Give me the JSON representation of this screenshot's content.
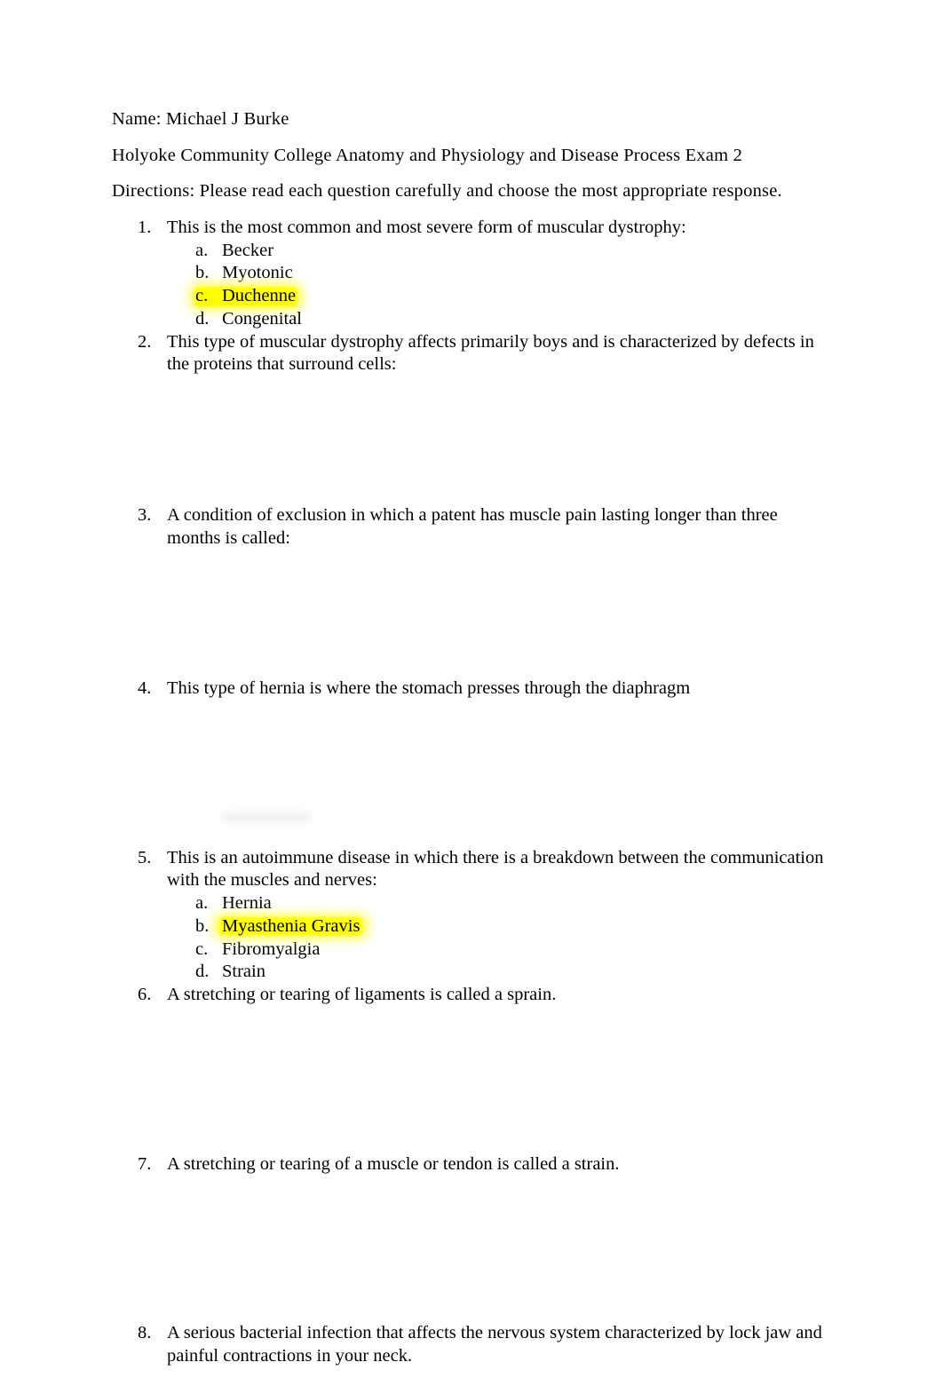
{
  "document": {
    "name_line": "Name: Michael J Burke",
    "title_line": "Holyoke Community College Anatomy and Physiology and Disease Process Exam 2",
    "directions_line": "Directions: Please read each question carefully and choose the most appropriate response."
  },
  "highlight_color": "#FFFF00",
  "questions": [
    {
      "number": "1.",
      "text": "This is the most common and most severe form of muscular dystrophy:",
      "options": [
        {
          "marker": "a.",
          "text": "Becker",
          "highlighted": false
        },
        {
          "marker": "b.",
          "text": "Myotonic",
          "highlighted": false
        },
        {
          "marker": "c.",
          "text": "Duchenne",
          "highlighted": true
        },
        {
          "marker": "d.",
          "text": "Congenital",
          "highlighted": false
        }
      ]
    },
    {
      "number": "2.",
      "text": "This type of muscular dystrophy affects primarily boys and is characterized by defects in the proteins that surround cells:",
      "options": []
    },
    {
      "number": "3.",
      "text": "A condition of exclusion in which a patent has muscle pain lasting longer than three months is called:",
      "options": []
    },
    {
      "number": "4.",
      "text": "This type of hernia is where the stomach presses through the diaphragm",
      "options": []
    },
    {
      "number": "5.",
      "text": "This is an autoimmune disease in which there is a breakdown between the communication with the muscles and nerves:",
      "options": [
        {
          "marker": "a.",
          "text": "Hernia",
          "highlighted": false
        },
        {
          "marker": "b.",
          "text": "Myasthenia Gravis",
          "highlighted": true
        },
        {
          "marker": "c.",
          "text": "Fibromyalgia",
          "highlighted": false
        },
        {
          "marker": "d.",
          "text": "Strain",
          "highlighted": false
        }
      ]
    },
    {
      "number": "6.",
      "text": "A stretching or tearing of ligaments is called a sprain.",
      "options": []
    },
    {
      "number": "7.",
      "text": "A stretching or tearing of a muscle or tendon is called a strain.",
      "options": []
    },
    {
      "number": "8.",
      "text": "A serious bacterial infection that affects the nervous system characterized by lock jaw and painful contractions in your neck.",
      "options": []
    }
  ]
}
